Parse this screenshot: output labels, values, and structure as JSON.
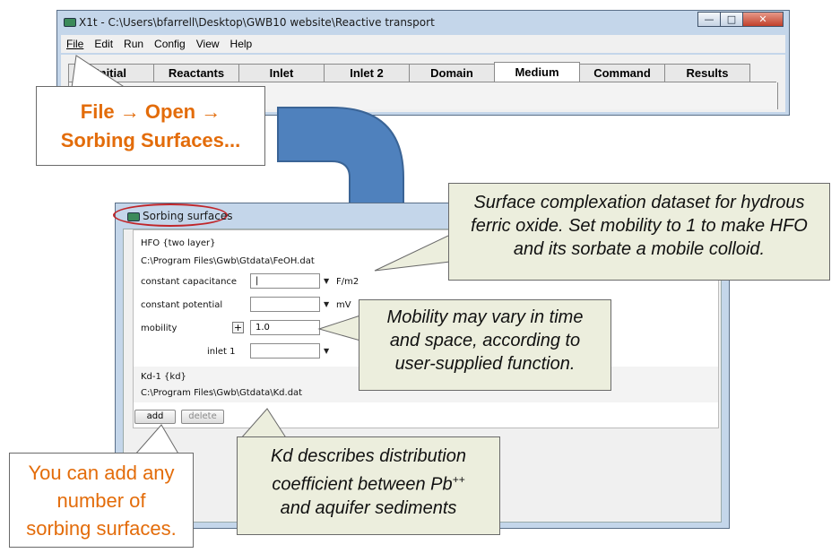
{
  "main_window": {
    "title": "X1t - C:\\Users\\bfarrell\\Desktop\\GWB10 website\\Reactive transport",
    "controls": {
      "minimize": "—",
      "maximize": "□",
      "close": "✕"
    },
    "menu": [
      "File",
      "Edit",
      "Run",
      "Config",
      "View",
      "Help"
    ],
    "tabs": [
      "Initial",
      "Reactants",
      "Inlet",
      "Inlet 2",
      "Domain",
      "Medium",
      "Command",
      "Results"
    ],
    "active_tab": "Medium"
  },
  "callouts": {
    "file_open": {
      "line1": "File → Open →",
      "line2": "Sorbing Surfaces..."
    },
    "hfo": {
      "line1": "Surface complexation dataset for hydrous",
      "line2": "ferric oxide. Set mobility to 1 to make HFO",
      "line3": "and its sorbate a mobile colloid."
    },
    "mobility": {
      "line1": "Mobility may vary in time",
      "line2": "and space, according to",
      "line3": "user-supplied function."
    },
    "kd": {
      "line1": "Kd describes distribution",
      "line2": "coefficient between Pb",
      "line2_sup": "++",
      "line3": "and aquifer sediments"
    },
    "add": {
      "line1": "You can add any",
      "line2": "number of",
      "line3": "sorbing surfaces."
    }
  },
  "sorbing_window": {
    "title": "Sorbing surfaces",
    "hfo": {
      "name": "HFO {two layer}",
      "path": "C:\\Program Files\\Gwb\\Gtdata\\FeOH.dat",
      "constant_capacitance_label": "constant capacitance",
      "constant_capacitance_value": "|",
      "constant_capacitance_unit": "F/m2",
      "constant_potential_label": "constant potential",
      "constant_potential_value": "",
      "constant_potential_unit": "mV",
      "mobility_label": "mobility",
      "mobility_plus": "+",
      "mobility_value": "1.0",
      "inlet_label": "inlet 1",
      "inlet_value": ""
    },
    "kd": {
      "name": "Kd-1 {kd}",
      "path": "C:\\Program Files\\Gwb\\Gtdata\\Kd.dat"
    },
    "buttons": {
      "add": "add",
      "delete": "delete"
    }
  },
  "colors": {
    "callout_orange_text": "#e36c0a",
    "callout_green_bg": "#eceedd",
    "arrow_blue": "#4f81bd",
    "highlight_red": "#c0262a"
  }
}
